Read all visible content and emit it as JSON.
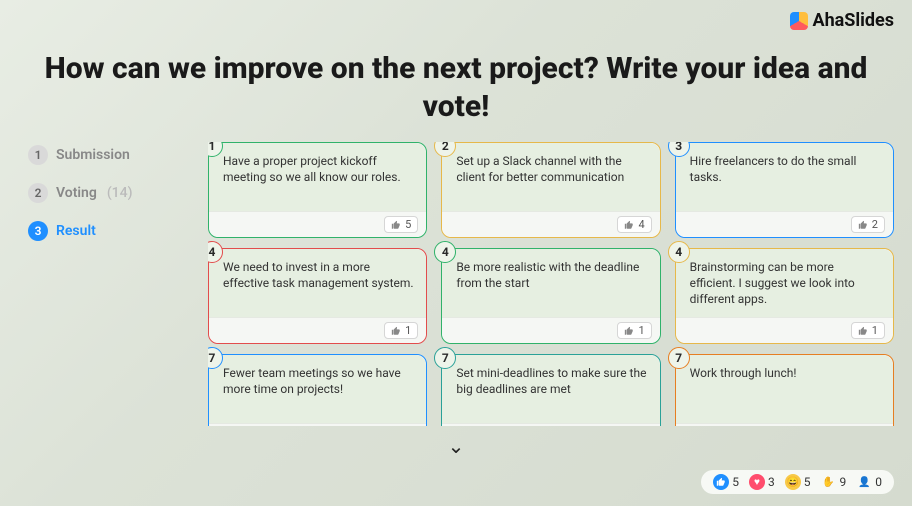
{
  "brand": "AhaSlides",
  "title": "How can we improve on the next project? Write your idea and vote!",
  "sidebar": {
    "steps": [
      {
        "num": "1",
        "label": "Submission",
        "count": ""
      },
      {
        "num": "2",
        "label": "Voting",
        "count": "(14)"
      },
      {
        "num": "3",
        "label": "Result",
        "count": ""
      }
    ]
  },
  "cards": [
    {
      "rank": "1",
      "text": "Have a proper project kickoff meeting so we all know our roles.",
      "votes": "5",
      "color": "b-green"
    },
    {
      "rank": "2",
      "text": "Set up a Slack channel with the client for better communication",
      "votes": "4",
      "color": "b-yellow"
    },
    {
      "rank": "3",
      "text": "Hire freelancers to do the small tasks.",
      "votes": "2",
      "color": "b-blue"
    },
    {
      "rank": "4",
      "text": "We need to invest in a more effective task management system.",
      "votes": "1",
      "color": "b-red"
    },
    {
      "rank": "4",
      "text": "Be more realistic with the deadline from the start",
      "votes": "1",
      "color": "b-green"
    },
    {
      "rank": "4",
      "text": "Brainstorming can be more efficient. I suggest we look into different apps.",
      "votes": "1",
      "color": "b-yellow"
    },
    {
      "rank": "7",
      "text": "Fewer team meetings so we have more time on projects!",
      "votes": "",
      "color": "b-blue"
    },
    {
      "rank": "7",
      "text": "Set mini-deadlines to make sure the big deadlines are met",
      "votes": "",
      "color": "b-teal"
    },
    {
      "rank": "7",
      "text": "Work through lunch!",
      "votes": "",
      "color": "b-orange"
    }
  ],
  "reactions": {
    "like": "5",
    "heart": "3",
    "laugh": "5",
    "hand": "9",
    "user": "0"
  },
  "icons": {
    "chevron": "⌄"
  }
}
